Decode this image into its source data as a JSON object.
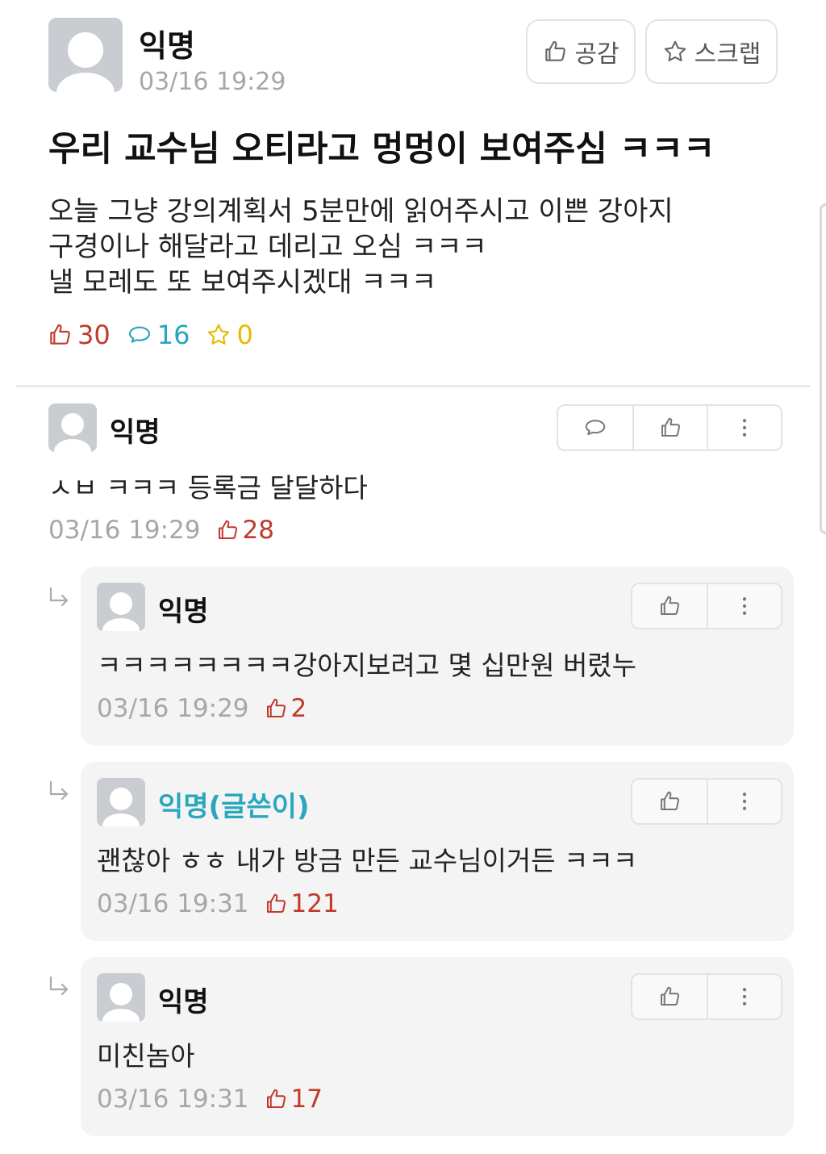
{
  "post": {
    "author": "익명",
    "time": "03/16 19:29",
    "like_button_label": "공감",
    "scrap_button_label": "스크랩",
    "title": "우리 교수님 오티라고 멍멍이 보여주심 ㅋㅋㅋ",
    "body_lines": [
      "오늘 그냥 강의계획서 5분만에 읽어주시고 이쁜 강아지",
      "구경이나 해달라고 데리고 오심 ㅋㅋㅋ",
      "낼 모레도 또 보여주시겠대 ㅋㅋㅋ"
    ],
    "stats": {
      "likes": "30",
      "comments": "16",
      "scraps": "0"
    }
  },
  "comments": [
    {
      "author": "익명",
      "text": "ㅅㅂ ㅋㅋㅋ 등록금 달달하다",
      "time": "03/16 19:29",
      "likes": "28"
    }
  ],
  "replies": [
    {
      "author": "익명",
      "text": "ㅋㅋㅋㅋㅋㅋㅋㅋ강아지보려고 몇 십만원 버렸누",
      "time": "03/16 19:29",
      "likes": "2"
    },
    {
      "author": "익명(글쓴이)",
      "text": "괜찮아 ㅎㅎ 내가 방금 만든 교수님이거든 ㅋㅋㅋ",
      "time": "03/16 19:31",
      "likes": "121"
    },
    {
      "author": "익명",
      "text": "미친놈아",
      "time": "03/16 19:31",
      "likes": "17"
    }
  ],
  "icons": {
    "like": "thumbs-up-icon",
    "comment": "speech-bubble-icon",
    "scrap": "star-icon",
    "more": "more-vertical-icon",
    "reply": "reply-arrow-icon"
  },
  "colors": {
    "like": "#c0392b",
    "comment": "#27a5bd",
    "scrap": "#e8b900",
    "op_author": "#2aa7bd",
    "meta": "#a7a7a7",
    "reply_bg": "#f4f4f4"
  }
}
